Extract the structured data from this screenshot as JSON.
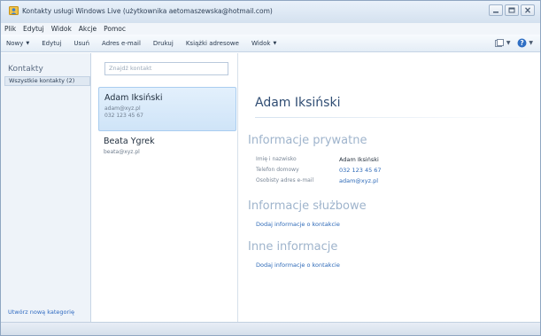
{
  "window": {
    "title": "Kontakty usługi Windows Live (użytkownika aetomaszewska@hotmail.com)"
  },
  "menu": [
    "Plik",
    "Edytuj",
    "Widok",
    "Akcje",
    "Pomoc"
  ],
  "toolbar": {
    "new_label": "Nowy",
    "edit_label": "Edytuj",
    "delete_label": "Usuń",
    "email_label": "Adres e-mail",
    "print_label": "Drukuj",
    "address_books_label": "Książki adresowe",
    "view_label": "Widok"
  },
  "sidebar": {
    "title": "Kontakty",
    "all_contacts": "Wszystkie kontakty (2)",
    "new_category": "Utwórz nową kategorię"
  },
  "list": {
    "search_placeholder": "Znajdź kontakt",
    "contacts": [
      {
        "name": "Adam Iksiński",
        "email": "adam@xyz.pl",
        "phone": "032 123 45 67"
      },
      {
        "name": "Beata Ygrek",
        "email": "beata@xyz.pl"
      }
    ]
  },
  "detail": {
    "name": "Adam Iksiński",
    "private_heading": "Informacje prywatne",
    "rows": [
      {
        "label": "Imię i nazwisko",
        "value": "Adam Iksiński"
      },
      {
        "label": "Telefon domowy",
        "value": "032 123 45 67"
      },
      {
        "label": "Osobisty adres e-mail",
        "value": "adam@xyz.pl"
      }
    ],
    "business_heading": "Informacje służbowe",
    "business_add": "Dodaj informacje o kontakcie",
    "other_heading": "Inne informacje",
    "other_add": "Dodaj informacje o kontakcie"
  },
  "colors": {
    "accent": "#2e6ab8",
    "selection": "#cfe4f8",
    "heading": "#9fb4cc"
  },
  "icons": [
    "contacts-app-icon",
    "minimize-icon",
    "maximize-icon",
    "close-icon",
    "layout-icon",
    "help-icon",
    "chevron-down-icon"
  ]
}
